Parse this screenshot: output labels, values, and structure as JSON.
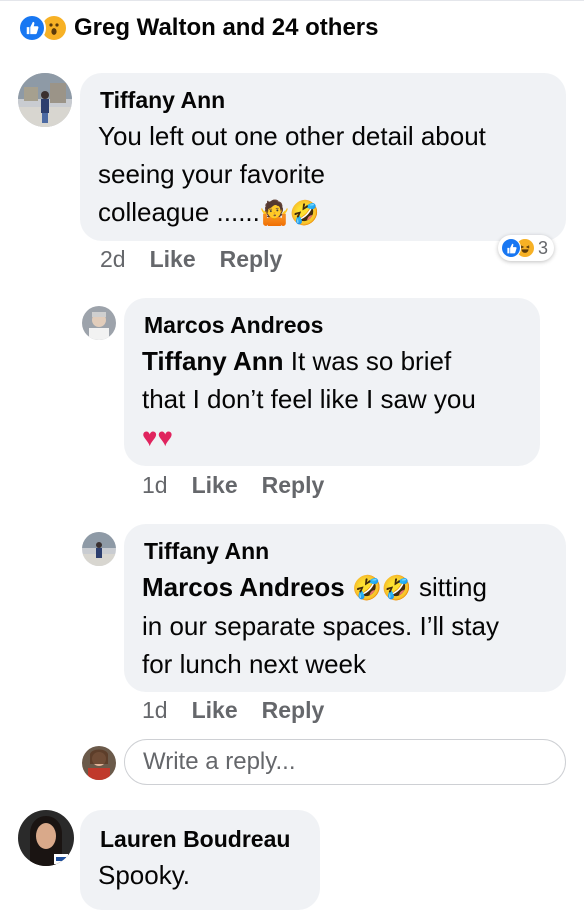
{
  "reaction_summary": {
    "icons": [
      "like-icon",
      "wow-icon"
    ],
    "text": "Greg Walton and 24 others"
  },
  "comments": [
    {
      "author": "Tiffany Ann",
      "lines": [
        "You left out one other detail about",
        "seeing your favorite"
      ],
      "last_line_text": "colleague ......",
      "emojis": "🤷🤣",
      "time": "2d",
      "like_label": "Like",
      "reply_label": "Reply",
      "reaction_count": "3",
      "reaction_icons": [
        "like-icon",
        "haha-icon"
      ]
    },
    {
      "author": "Marcos Andreos",
      "mention": "Tiffany Ann",
      "line1_rest": " It was so brief",
      "line2": "that I don’t feel like I saw you",
      "emojis": "♥♥",
      "time": "1d",
      "like_label": "Like",
      "reply_label": "Reply"
    },
    {
      "author": "Tiffany Ann",
      "mention": "Marcos Andreos",
      "emojis": "🤣🤣",
      "line1_rest": " sitting",
      "line2": "in our separate spaces. I’ll stay",
      "line3": "for lunch next week",
      "time": "1d",
      "like_label": "Like",
      "reply_label": "Reply"
    },
    {
      "author": "Lauren Boudreau",
      "text": "Spooky."
    }
  ],
  "reply_box": {
    "placeholder": "Write a reply..."
  },
  "colors": {
    "bubble": "#f0f2f5",
    "like_blue": "#1877f2",
    "reaction_yellow": "#f7b125",
    "secondary_text": "#65676b"
  }
}
